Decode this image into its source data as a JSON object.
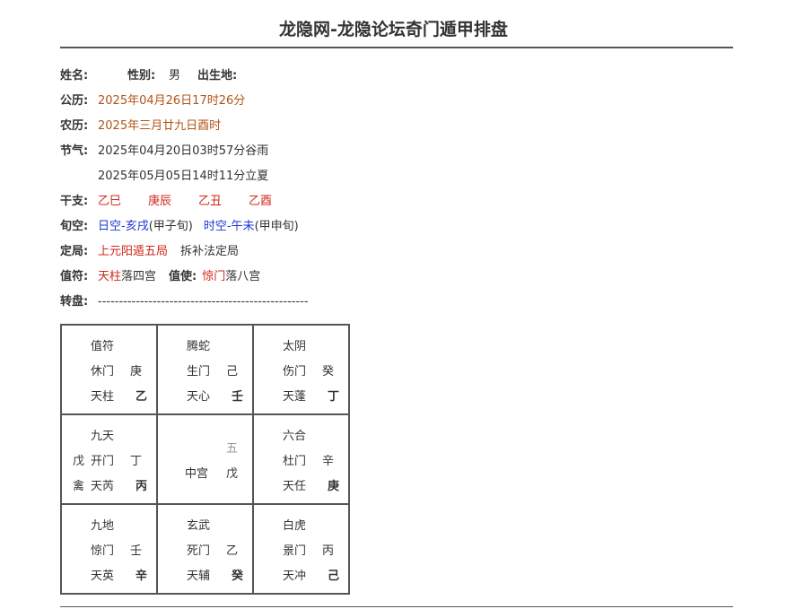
{
  "header": {
    "title": "龙隐网-龙隐论坛奇门遁甲排盘"
  },
  "info": {
    "name_label": "姓名:",
    "name_value": "",
    "gender_label": "性别:",
    "gender_value": "男",
    "birthplace_label": "出生地:",
    "birthplace_value": "",
    "solar_label": "公历:",
    "solar_value": "2025年04月26日17时26分",
    "lunar_label": "农历:",
    "lunar_value": "2025年三月廿九日酉时",
    "solar_term_label": "节气:",
    "solar_term_1": "2025年04月20日03时57分谷雨",
    "solar_term_2": "2025年05月05日14时11分立夏",
    "ganzhi_label": "干支:",
    "ganzhi": [
      "乙巳",
      "庚辰",
      "乙丑",
      "乙酉"
    ],
    "xunkong_label": "旬空:",
    "day_kong": "日空-亥戌",
    "day_xun": "(甲子旬)",
    "hour_kong": "时空-午未",
    "hour_xun": "(甲申旬)",
    "ju_label": "定局:",
    "ju_value": "上元阳遁五局",
    "ju_method": "拆补法定局",
    "zhifu_label": "值符:",
    "zhifu_star": "天柱",
    "zhifu_palace": "落四宫",
    "zhishi_label": "值使:",
    "zhishi_door": "惊门",
    "zhishi_palace": "落八宫",
    "zhuanpan_label": "转盘:",
    "zhuanpan_dashes": "--------------------------------------------------"
  },
  "grid": [
    {
      "god": "值符",
      "door": "休门",
      "door_stem": "庚",
      "star": "天柱",
      "star_stem": "乙",
      "prefix_door": "",
      "prefix_star": ""
    },
    {
      "god": "腾蛇",
      "door": "生门",
      "door_stem": "己",
      "star": "天心",
      "star_stem": "壬",
      "prefix_door": "",
      "prefix_star": ""
    },
    {
      "god": "太阴",
      "door": "伤门",
      "door_stem": "癸",
      "star": "天蓬",
      "star_stem": "丁",
      "prefix_door": "",
      "prefix_star": ""
    },
    {
      "god": "九天",
      "door": "开门",
      "door_stem": "丁",
      "star": "天芮",
      "star_stem": "丙",
      "prefix_door": "戊",
      "prefix_star": "禽"
    },
    {
      "center_num": "五",
      "center_label": "中宫",
      "center_stem": "戊"
    },
    {
      "god": "六合",
      "door": "杜门",
      "door_stem": "辛",
      "star": "天任",
      "star_stem": "庚",
      "prefix_door": "",
      "prefix_star": ""
    },
    {
      "god": "九地",
      "door": "惊门",
      "door_stem": "壬",
      "star": "天英",
      "star_stem": "辛",
      "prefix_door": "",
      "prefix_star": ""
    },
    {
      "god": "玄武",
      "door": "死门",
      "door_stem": "乙",
      "star": "天辅",
      "star_stem": "癸",
      "prefix_door": "",
      "prefix_star": ""
    },
    {
      "god": "白虎",
      "door": "景门",
      "door_stem": "丙",
      "star": "天冲",
      "star_stem": "己",
      "prefix_door": "",
      "prefix_star": ""
    }
  ]
}
